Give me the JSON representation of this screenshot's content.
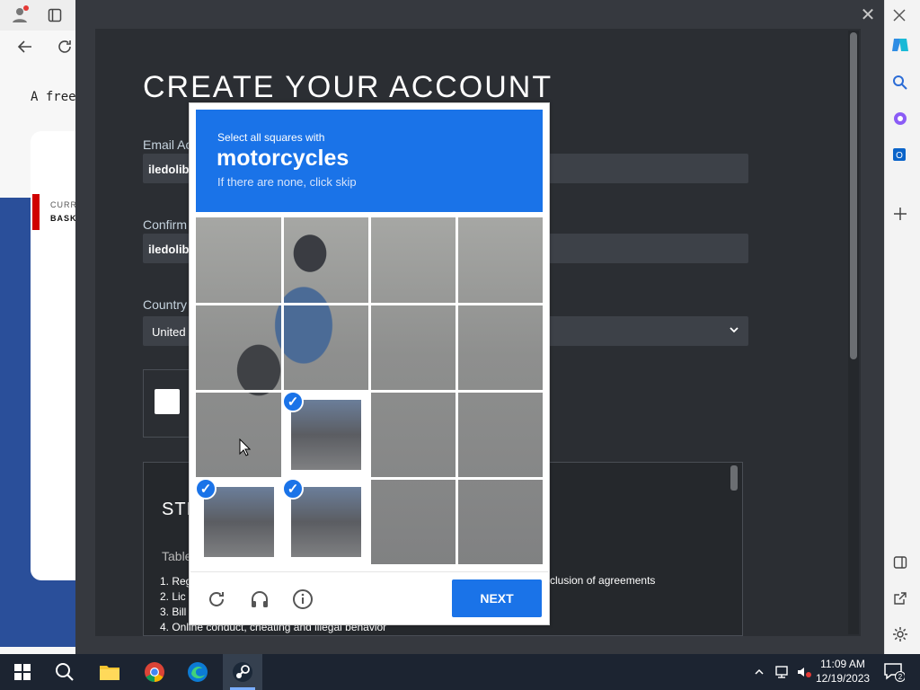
{
  "browser": {
    "address_text": "A free",
    "card_line1": "CURR",
    "card_line2": "BASK"
  },
  "modal": {
    "title": "CREATE YOUR ACCOUNT",
    "email_label": "Email Ac",
    "email_value": "iledolib",
    "confirm_label": "Confirm",
    "confirm_value": "iledolib",
    "country_label": "Country",
    "country_value": "United",
    "terms_heading": "STI",
    "terms_sub": "Table",
    "terms_lines": [
      "1. Reg",
      "2. Lic",
      "3. Bill",
      "4. Online conduct, cheating and illegal behavior"
    ],
    "terms_right": "clusion of agreements"
  },
  "recaptcha": {
    "instruction": "Select all squares with",
    "target": "motorcycles",
    "hint": "If there are none, click skip",
    "next_label": "NEXT",
    "selected_tiles": [
      9,
      12,
      13
    ]
  },
  "taskbar": {
    "time": "11:09 AM",
    "date": "12/19/2023",
    "notification_count": "2"
  },
  "colors": {
    "recaptcha_blue": "#1a73e8",
    "steam_dark": "#2b2e33",
    "taskbar": "#1c2431"
  }
}
